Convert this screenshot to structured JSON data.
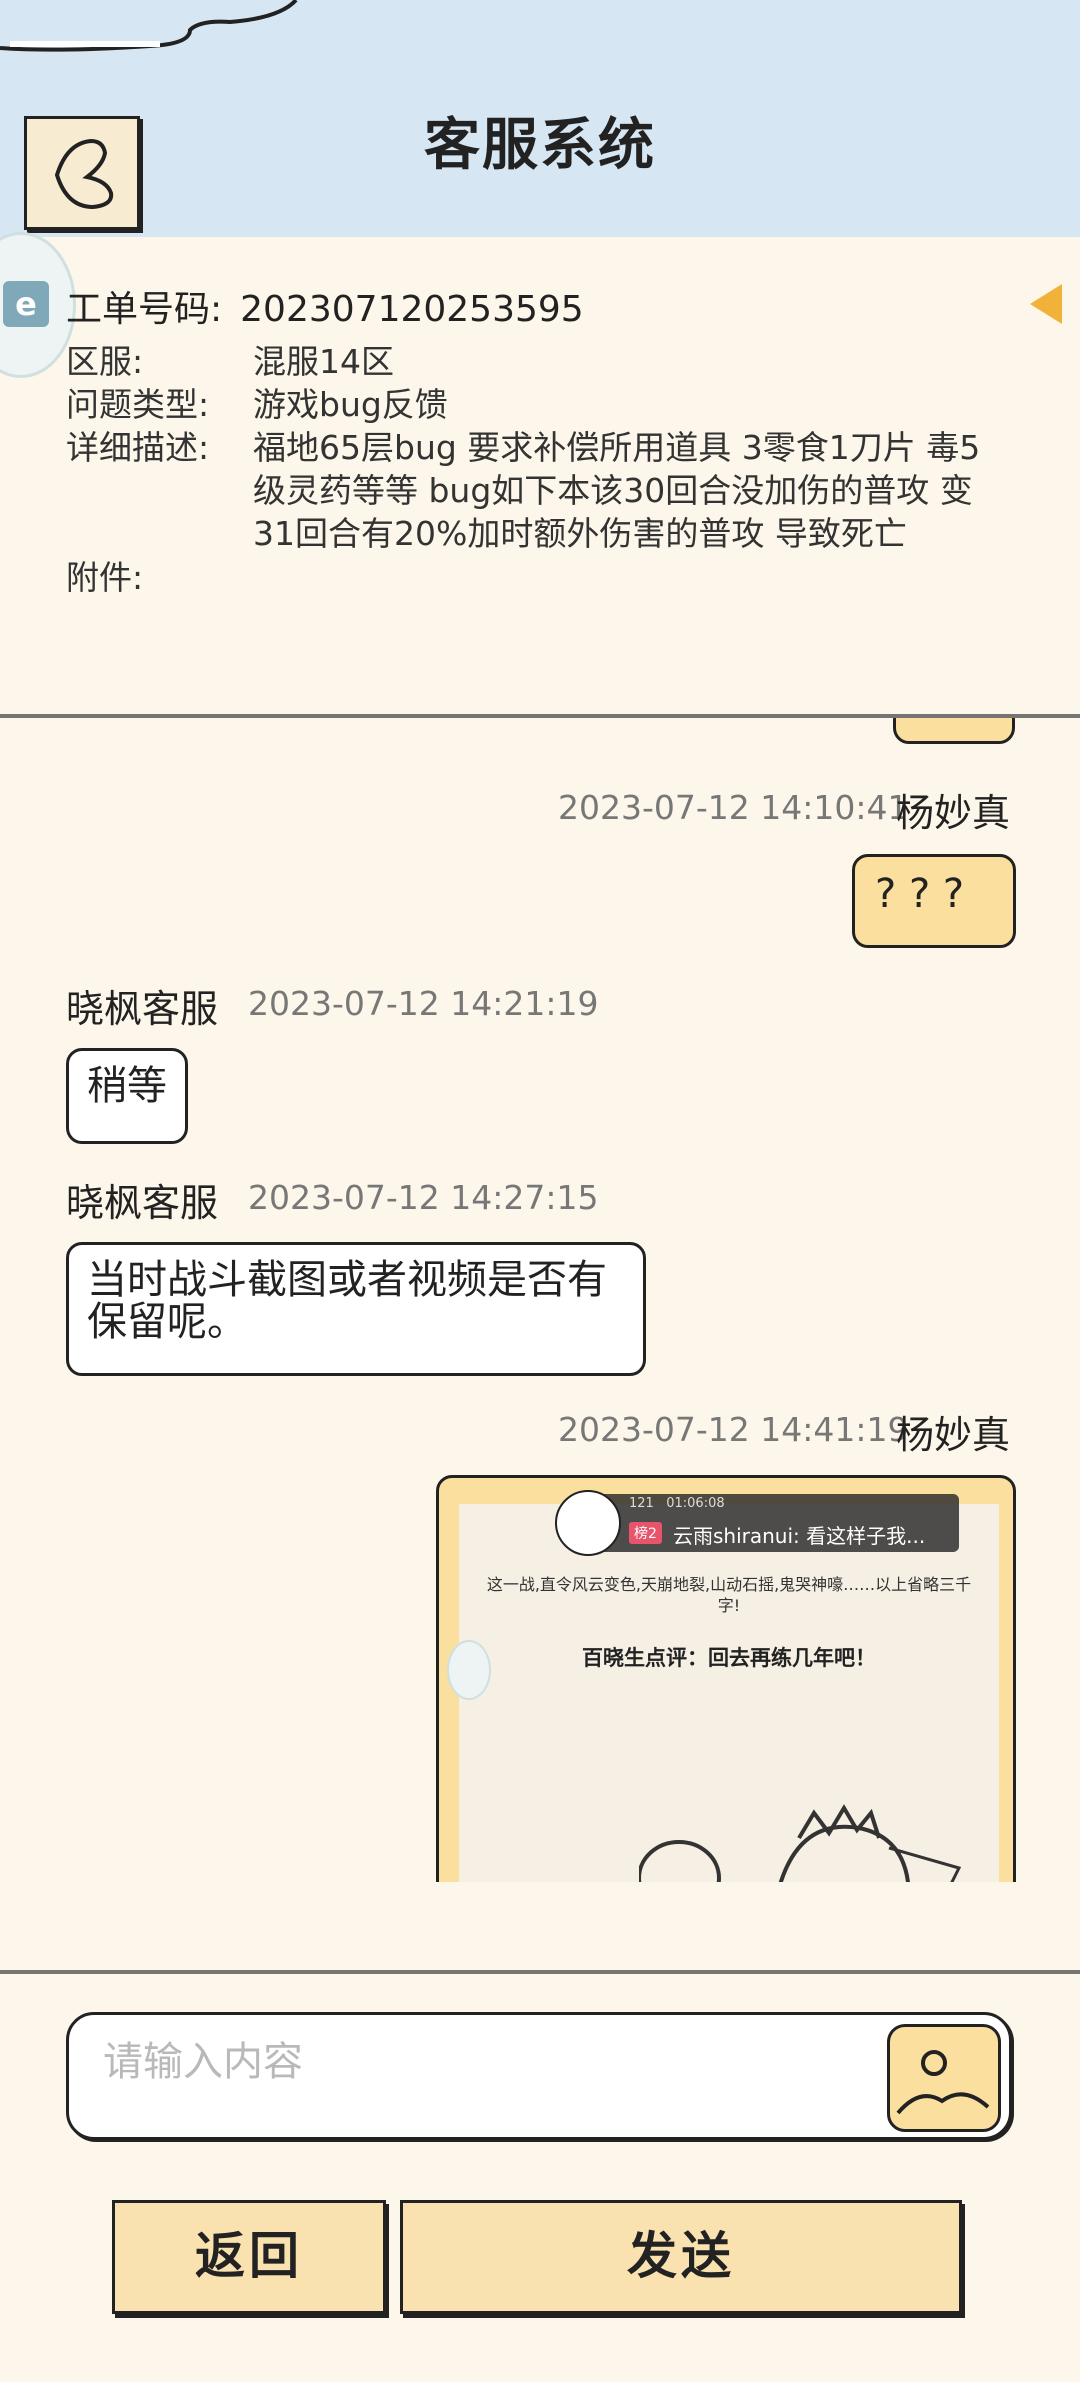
{
  "header": {
    "title": "客服系统"
  },
  "ticket": {
    "order_label": "工单号码:",
    "order_value": "202307120253595",
    "rows": [
      {
        "label": "区服:",
        "value": "混服14区"
      },
      {
        "label": "问题类型:",
        "value": "游戏bug反馈"
      },
      {
        "label": "详细描述:",
        "value": "福地65层bug 要求补偿所用道具 3零食1刀片 毒5级灵药等等 bug如下本该30回合没加伤的普攻 变31回合有20%加时额外伤害的普攻 导致死亡"
      },
      {
        "label": "附件:",
        "value": ""
      }
    ]
  },
  "messages": [
    {
      "time": "2023-07-12 14:10:41",
      "sender": "杨妙真",
      "text": "? ? ?"
    },
    {
      "time": "2023-07-12 14:21:19",
      "sender": "晓枫客服",
      "text": "稍等"
    },
    {
      "time": "2023-07-12 14:27:15",
      "sender": "晓枫客服",
      "text": "当时战斗截图或者视频是否有保留呢。"
    },
    {
      "time": "2023-07-12 14:41:19",
      "sender": "杨妙真",
      "text": ""
    }
  ],
  "screenshot": {
    "stat_likes": "121",
    "stat_time": "01:06:08",
    "tag": "榜2",
    "danmaku": "云雨shiranui: 看这样子我...",
    "story_text": "这一战,直令风云变色,天崩地裂,山动石摇,鬼哭神嚎……以上省略三千字!",
    "review": "百晓生点评：回去再练几年吧！"
  },
  "input": {
    "placeholder": "请输入内容"
  },
  "buttons": {
    "back": "返回",
    "send": "发送"
  }
}
